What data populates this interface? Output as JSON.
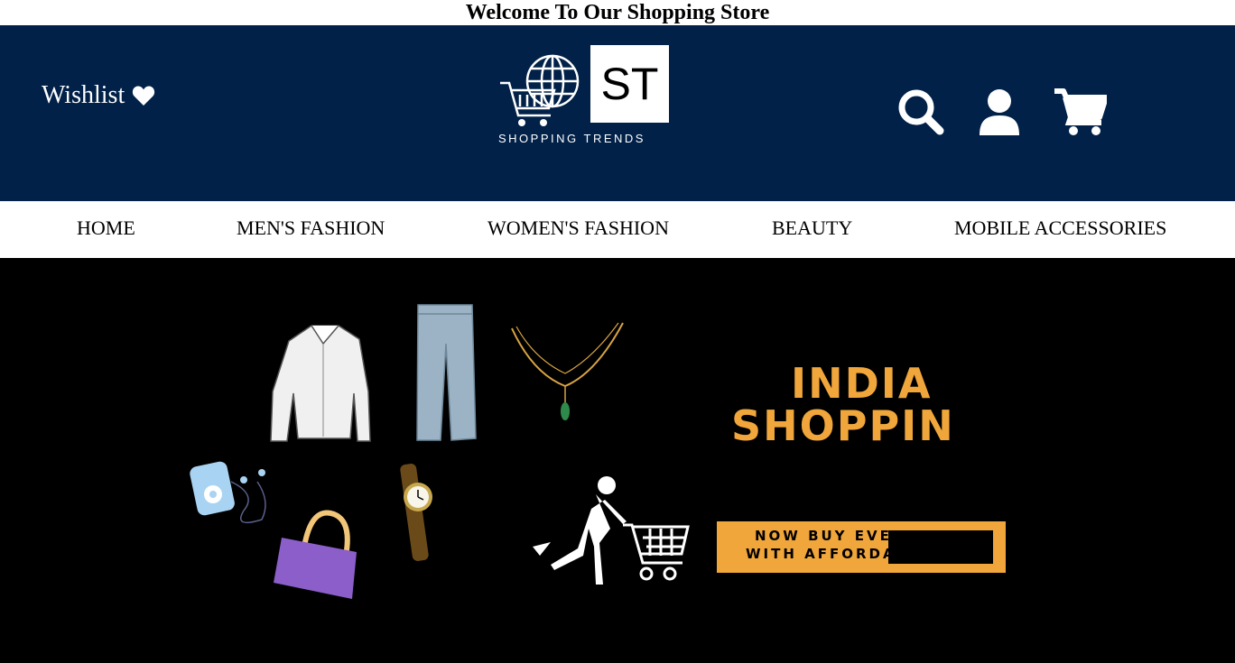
{
  "top_banner": {
    "text": "Welcome To Our Shopping Store"
  },
  "header": {
    "wishlist_label": "Wishlist",
    "logo": {
      "mark": "ST",
      "caption": "SHOPPING TRENDS"
    },
    "icons": [
      "search-icon",
      "user-icon",
      "cart-icon"
    ],
    "background": "#012148"
  },
  "nav": {
    "items": [
      {
        "label": "HOME"
      },
      {
        "label": "MEN'S FASHION"
      },
      {
        "label": "WOMEN'S FASHION"
      },
      {
        "label": "BEAUTY"
      },
      {
        "label": "MOBILE ACCESSORIES"
      }
    ]
  },
  "hero": {
    "headline_line1": "INDIA",
    "headline_line2": "SHOPPIN",
    "cta_line1": "NOW BUY EVE",
    "cta_line2": "WITH AFFORDA",
    "accent": "#f0a63b",
    "background": "#000000"
  }
}
